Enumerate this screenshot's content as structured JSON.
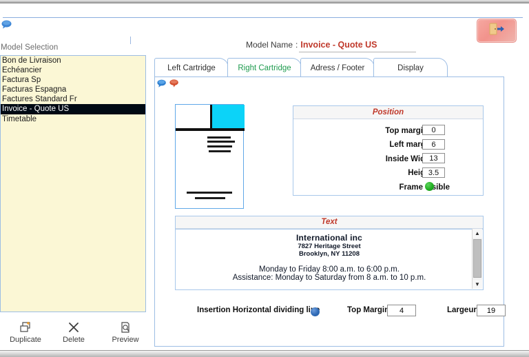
{
  "window": {
    "exit_button_icon": "exit-door-icon",
    "top_left_icon": "blue-speech-bubble-icon"
  },
  "sidebar": {
    "label": "Model Selection",
    "items": [
      {
        "label": "Bon de Livraison",
        "selected": false
      },
      {
        "label": "Echéancier",
        "selected": false
      },
      {
        "label": "Factura Sp",
        "selected": false
      },
      {
        "label": "Facturas  Espagna",
        "selected": false
      },
      {
        "label": "Factures Standard Fr",
        "selected": false
      },
      {
        "label": "Invoice - Quote US",
        "selected": true
      },
      {
        "label": "Timetable",
        "selected": false
      }
    ],
    "actions": [
      {
        "label": "Duplicate",
        "icon": "duplicate-icon"
      },
      {
        "label": "Delete",
        "icon": "close-x-icon"
      },
      {
        "label": "Preview",
        "icon": "magnifier-page-icon"
      }
    ]
  },
  "header": {
    "model_name_label": "Model Name",
    "colon": ":",
    "model_name_value": "Invoice - Quote US"
  },
  "tabs": [
    {
      "label": "Left Cartridge",
      "active": false
    },
    {
      "label": "Right Cartridge",
      "active": true
    },
    {
      "label": "Adress /  Footer",
      "active": false
    },
    {
      "label": "Display",
      "active": false
    }
  ],
  "panel": {
    "bubbles": [
      "blue-speech-bubble-icon",
      "red-speech-bubble-icon"
    ],
    "thumbnail_icon": "document-layout-preview"
  },
  "position": {
    "title": "Position",
    "fields": [
      {
        "label": "Top marging",
        "value": "0"
      },
      {
        "label": "Left margin",
        "value": "6"
      },
      {
        "label": "Inside Width",
        "value": "13"
      },
      {
        "label": "Height",
        "value": "3.5"
      }
    ],
    "frame_visible_label": "Frame visible",
    "frame_visible_color": "#21ae21"
  },
  "text_block": {
    "title": "Text",
    "company": "International inc",
    "street": "7827 Heritage Street",
    "city": "Brooklyn, NY 11208",
    "hours_line_1": "Monday to Friday 8:00 a.m. to 6:00 p.m.",
    "hours_line_2": "Assistance: Monday to Saturday from 8 a.m. to 10 p.m.",
    "scroll_up_glyph": "▲",
    "scroll_down_glyph": "▼"
  },
  "bottom_row": {
    "insertion_label": "Insertion Horizontal dividing line",
    "insertion_dot_color": "#2f6ab6",
    "top_margin_label": "Top Margin",
    "top_margin_value": "4",
    "largeur_label": "Largeur",
    "largeur_value": "19"
  },
  "colors": {
    "accent_blue": "#9cbde4",
    "list_background": "#fbf7d5",
    "title_red": "#c0392b",
    "active_tab_green": "#1e9b4e",
    "thumb_cyan": "#0cd3f8"
  }
}
